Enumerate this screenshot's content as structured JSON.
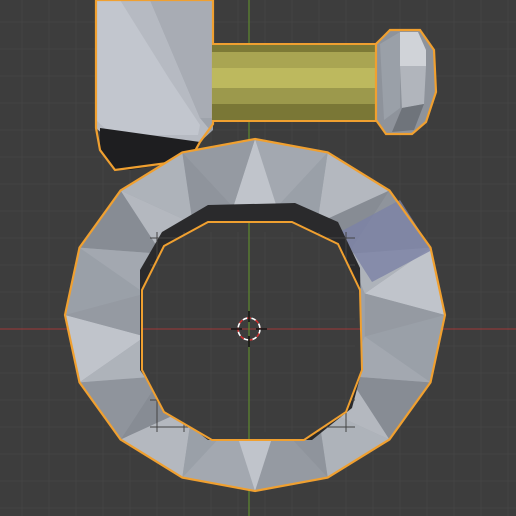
{
  "viewport": {
    "background": "#3d3d3d",
    "grid_color_minor": "#444444",
    "grid_color_major": "#4a4a4a",
    "x_axis_color": "#8c3a3a",
    "y_axis_color": "#5f8a2e",
    "selection_outline_color": "#f0a030"
  },
  "objects": [
    {
      "name": "block",
      "selected": true
    },
    {
      "name": "rod",
      "selected": true,
      "material_color": "#b9b65a"
    },
    {
      "name": "rod-cap",
      "selected": true
    },
    {
      "name": "ring",
      "selected": true
    }
  ],
  "cursor": {
    "icon": "3d-cursor-icon"
  }
}
